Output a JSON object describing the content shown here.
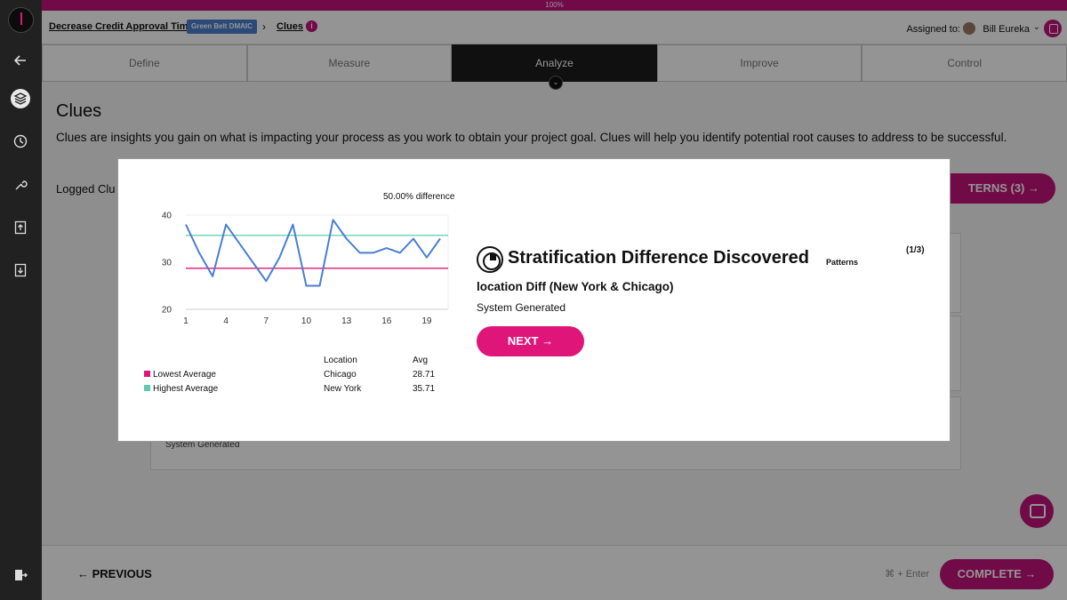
{
  "progress": {
    "label": "100%",
    "value": 1.0
  },
  "breadcrumb": {
    "project": "Decrease Credit Approval Time",
    "badge": "Green Belt DMAIC",
    "separator": "›",
    "page": "Clues",
    "info": "i"
  },
  "assignment": {
    "label": "Assigned to:",
    "name": "Bill Eureka",
    "chevron": "⌄"
  },
  "phases": [
    "Define",
    "Measure",
    "Analyze",
    "Improve",
    "Control"
  ],
  "active_phase": "Analyze",
  "page": {
    "title": "Clues",
    "description": "Clues are insights you gain on what is impacting your process as you work to obtain your project goal. Clues will help you identify potential root causes to address to be successful.",
    "logged_label": "Logged Clu",
    "patterns_button": "TERNS (3) →",
    "card_source": "System Generated"
  },
  "footer": {
    "previous": "← PREVIOUS",
    "shortcut": "⌘ + Enter",
    "complete": "COMPLETE →"
  },
  "modal": {
    "title": "Stratification Difference Discovered",
    "tag": "Patterns",
    "counter": "(1/3)",
    "subtitle": "location Diff (New York & Chicago)",
    "source": "System Generated",
    "next": "NEXT →",
    "legend_table": {
      "headers": [
        "Location",
        "Avg"
      ],
      "rows": [
        {
          "label": "Lowest Average",
          "color": "#e0157a",
          "location": "Chicago",
          "avg": "28.71"
        },
        {
          "label": "Highest Average",
          "color": "#5cc9b0",
          "location": "New York",
          "avg": "35.71"
        }
      ]
    }
  },
  "chart_data": {
    "type": "line",
    "title": "50.00% difference",
    "x": [
      1,
      2,
      3,
      4,
      5,
      6,
      7,
      8,
      9,
      10,
      11,
      12,
      13,
      14,
      15,
      16,
      17,
      18,
      19,
      20
    ],
    "series": [
      {
        "values": [
          38,
          32,
          27,
          38,
          34,
          30,
          26,
          31,
          38,
          25,
          25,
          39,
          35,
          32,
          32,
          33,
          32,
          35,
          31,
          35
        ],
        "color": "#4a7fd1"
      }
    ],
    "reference_lines": [
      {
        "value": 28.71,
        "color": "#e0157a"
      },
      {
        "value": 35.71,
        "color": "#5cc9b0"
      }
    ],
    "xticks": [
      1,
      4,
      7,
      10,
      13,
      16,
      19
    ],
    "yticks": [
      20,
      30,
      40
    ],
    "ylim": [
      20,
      40
    ],
    "xlim": [
      1,
      20
    ],
    "grid": false
  }
}
